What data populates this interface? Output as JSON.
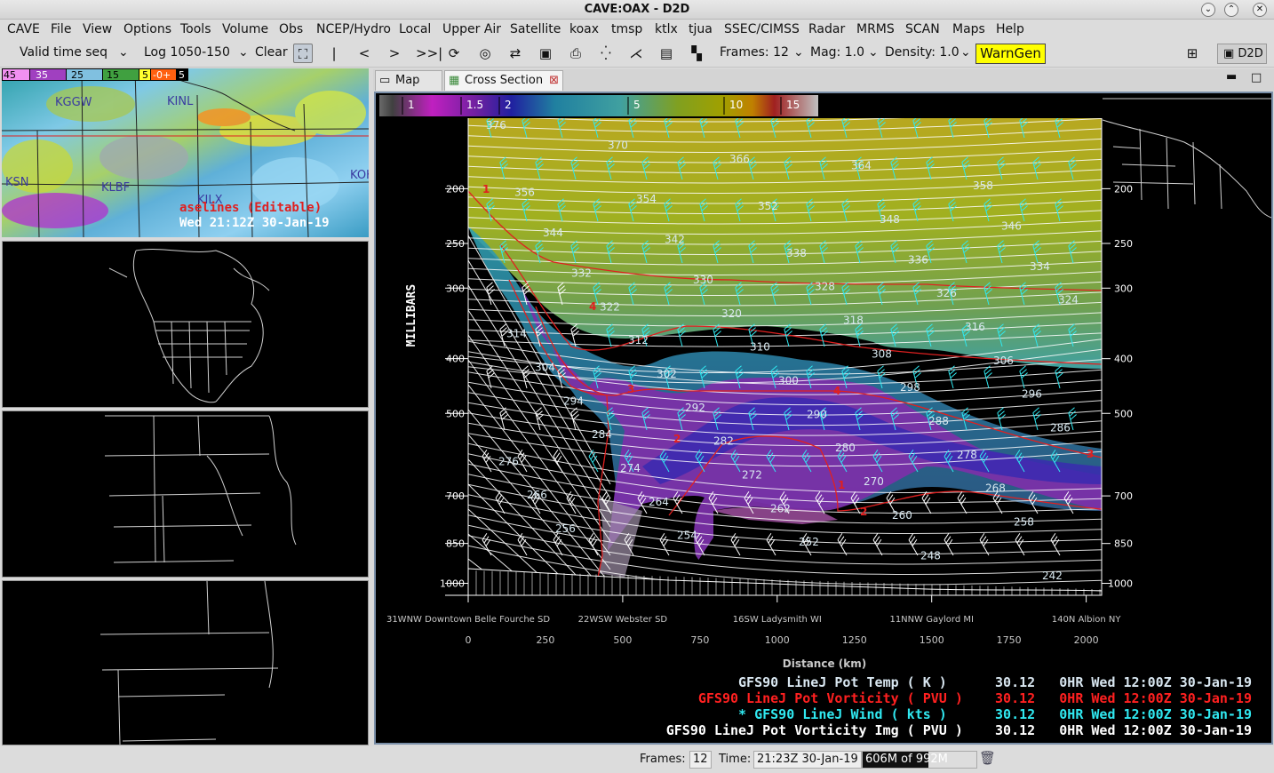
{
  "window": {
    "title": "CAVE:OAX - D2D"
  },
  "menu": [
    "CAVE",
    "File",
    "View",
    "Options",
    "Tools",
    "Volume",
    "Obs",
    "NCEP/Hydro",
    "Local",
    "Upper Air",
    "Satellite",
    "koax",
    "tmsp",
    "ktlx",
    "tjua",
    "SSEC/CIMSS",
    "Radar",
    "MRMS",
    "SCAN",
    "Maps",
    "Help"
  ],
  "toolbar": {
    "time_mode": "Valid time seq",
    "levels": "Log 1050-150",
    "clear": "Clear",
    "frames": "Frames: 12",
    "mag": "Mag: 1.0",
    "density": "Density: 1.0",
    "warngen": "WarnGen",
    "perspective": "D2D"
  },
  "icons": [
    "fullscreen-icon",
    "first-frame-icon",
    "step-back-icon",
    "step-forward-icon",
    "last-frame-icon",
    "loop-icon",
    "image-properties-icon",
    "swap-icon",
    "print-icon",
    "points-icon",
    "baselines-icon",
    "panel-layout-1-icon",
    "panel-layout-4-icon"
  ],
  "panes": {
    "main_scale": [
      "45",
      "35",
      "25",
      "15",
      "5",
      "-0+",
      "5"
    ],
    "stations": [
      "KGGW",
      "KINL",
      "KSN",
      "KLBF",
      "KILX",
      "KOK"
    ],
    "baselines_label": "aselines (Editable)",
    "valid_time": "Wed 21:12Z 30-Jan-19"
  },
  "tabs": [
    {
      "label": "Map",
      "active": false
    },
    {
      "label": "Cross Section",
      "active": true,
      "close": "⊠"
    }
  ],
  "cross_section": {
    "colorbar_ticks": [
      "1",
      "1.5",
      "2",
      "5",
      "10",
      "15"
    ],
    "yaxis_label": "MILLIBARS",
    "pressure_ticks": [
      {
        "p": 200,
        "label": "200"
      },
      {
        "p": 250,
        "label": "250"
      },
      {
        "p": 300,
        "label": "300"
      },
      {
        "p": 400,
        "label": "400"
      },
      {
        "p": 500,
        "label": "500"
      },
      {
        "p": 700,
        "label": "700"
      },
      {
        "p": 850,
        "label": "850"
      },
      {
        "p": 1000,
        "label": "1000"
      }
    ],
    "locations": [
      {
        "d": 0,
        "label": "31WNW Downtown Belle Fourche SD"
      },
      {
        "d": 500,
        "label": "22WSW Webster SD"
      },
      {
        "d": 1000,
        "label": "16SW Ladysmith WI"
      },
      {
        "d": 1500,
        "label": "11NNW Gaylord MI"
      },
      {
        "d": 2000,
        "label": "140N Albion NY"
      }
    ],
    "distance_ticks": [
      "0",
      "250",
      "500",
      "750",
      "1000",
      "1250",
      "1500",
      "1750",
      "2000"
    ],
    "xaxis_label": "Distance (km)",
    "theta_labels": [
      "376",
      "370",
      "366",
      "364",
      "358",
      "356",
      "354",
      "352",
      "348",
      "346",
      "344",
      "342",
      "338",
      "336",
      "334",
      "332",
      "330",
      "328",
      "326",
      "324",
      "322",
      "320",
      "318",
      "316",
      "314",
      "312",
      "310",
      "308",
      "306",
      "304",
      "302",
      "300",
      "298",
      "296",
      "294",
      "292",
      "290",
      "288",
      "286",
      "284",
      "282",
      "280",
      "278",
      "276",
      "274",
      "272",
      "270",
      "268",
      "266",
      "264",
      "262",
      "260",
      "258",
      "256",
      "254",
      "252",
      "248",
      "242"
    ],
    "pv_contour_labels": [
      "1",
      "2",
      "3",
      "4"
    ]
  },
  "legend": [
    {
      "text": "GFS90 LineJ Pot Temp ( K )      30.12   0HR Wed 12:00Z 30-Jan-19",
      "color": "#d8e6f0"
    },
    {
      "text": "GFS90 LineJ Pot Vorticity ( PVU )    30.12   0HR Wed 12:00Z 30-Jan-19",
      "color": "#ff2020"
    },
    {
      "text": "* GFS90 LineJ Wind ( kts )      30.12   0HR Wed 12:00Z 30-Jan-19",
      "color": "#30e8f0"
    },
    {
      "text": "GFS90 LineJ Pot Vorticity Img ( PVU )    30.12   0HR Wed 12:00Z 30-Jan-19",
      "color": "#ffffff"
    }
  ],
  "status": {
    "frames_label": "Frames:",
    "frames_value": "12",
    "time_label": "Time:",
    "time_value": "21:23Z 30-Jan-19",
    "memory": "606M of 992M"
  }
}
